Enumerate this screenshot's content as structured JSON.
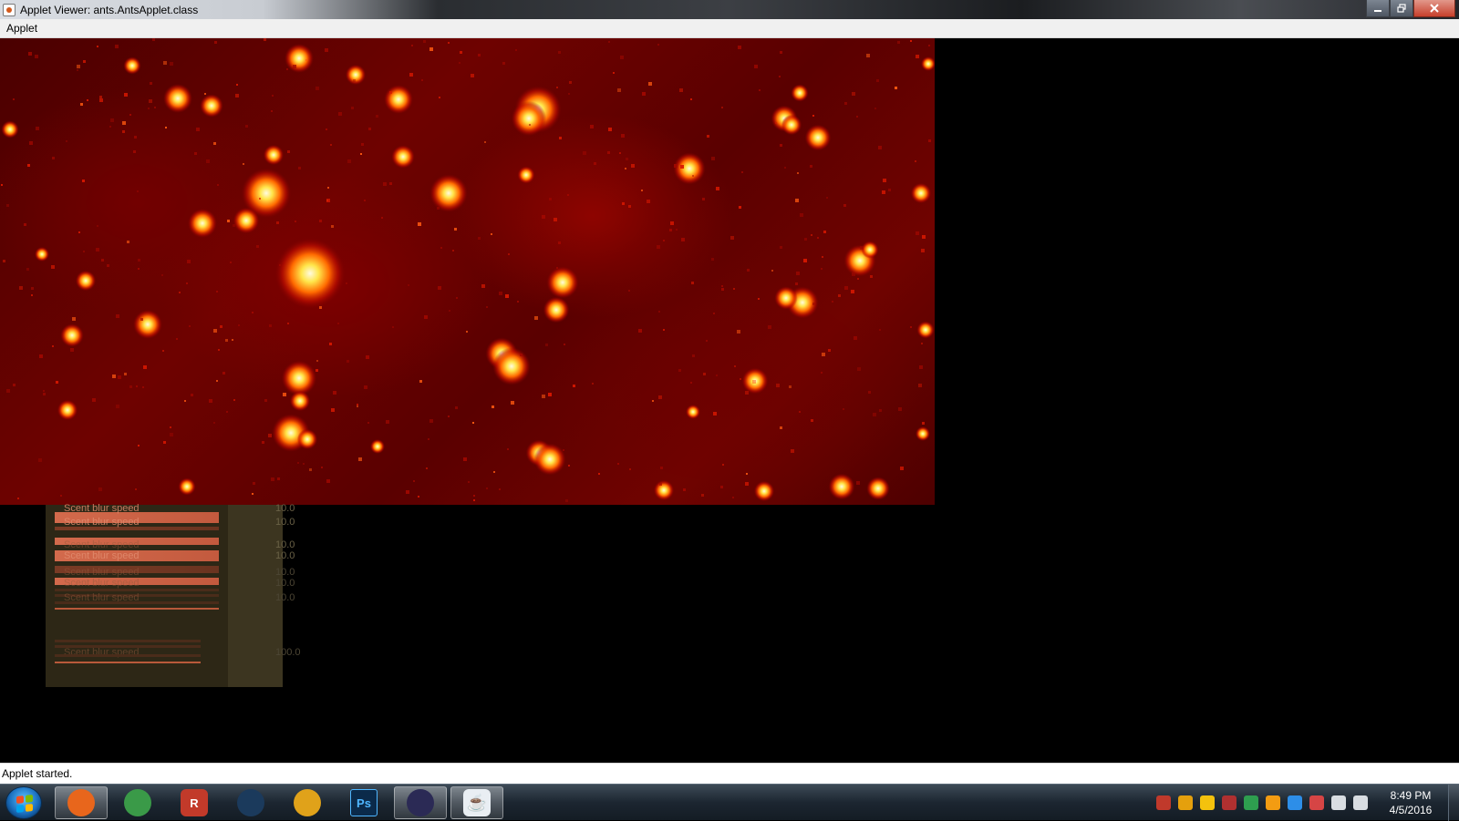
{
  "window": {
    "title": "Applet Viewer: ants.AntsApplet.class"
  },
  "menubar": {
    "items": [
      {
        "label": "Applet"
      }
    ]
  },
  "controls": {
    "rows": [
      {
        "label": "Scent blur speed",
        "value": "10.0"
      },
      {
        "label": "Scent blur speed",
        "value": "10.0"
      },
      {
        "label": "Scent blur speed",
        "value": "10.0"
      },
      {
        "label": "Scent blur speed",
        "value": "10.0"
      },
      {
        "label": "Scent blur speed",
        "value": "10.0"
      },
      {
        "label": "Scent blur speed",
        "value": "10.0"
      },
      {
        "label": "Scent blur speed",
        "value": "10.0"
      },
      {
        "label": "Scent blur speed",
        "value": "100.0"
      }
    ]
  },
  "statusbar": {
    "text": "Applet started."
  },
  "taskbar": {
    "apps": [
      {
        "name": "firefox-icon",
        "glyph": "",
        "color": "#e8661c",
        "active": true
      },
      {
        "name": "globe-icon",
        "glyph": "",
        "color": "#3a9a48",
        "active": false
      },
      {
        "name": "roblox-icon",
        "glyph": "R",
        "color": "#c23a2a",
        "active": false
      },
      {
        "name": "steam-icon",
        "glyph": "",
        "color": "#1b3a5c",
        "active": false
      },
      {
        "name": "fl-studio-icon",
        "glyph": "",
        "color": "#e0a21a",
        "active": false
      },
      {
        "name": "photoshop-icon",
        "glyph": "Ps",
        "color": "#0b2a4a",
        "active": false
      },
      {
        "name": "eclipse-icon",
        "glyph": "",
        "color": "#2b2a55",
        "active": true
      },
      {
        "name": "java-icon",
        "glyph": "",
        "color": "#e9eef3",
        "active": true
      }
    ],
    "tray_icons": [
      {
        "name": "tray-shield-icon",
        "color": "#c0392b"
      },
      {
        "name": "tray-plex-icon",
        "color": "#e5a00d"
      },
      {
        "name": "tray-chrome-icon",
        "color": "#f4c20d"
      },
      {
        "name": "tray-network-x-icon",
        "color": "#b03030"
      },
      {
        "name": "tray-google-drive-icon",
        "color": "#2e9e4f"
      },
      {
        "name": "tray-headphones-icon",
        "color": "#f39c12"
      },
      {
        "name": "tray-dropbox-icon",
        "color": "#2d8ee8"
      },
      {
        "name": "tray-power-icon",
        "color": "#d64545"
      },
      {
        "name": "tray-volume-icon",
        "color": "#d8dde2"
      },
      {
        "name": "tray-signal-icon",
        "color": "#d8dde2"
      }
    ],
    "clock_time": "8:49 PM",
    "clock_date": "4/5/2016"
  }
}
